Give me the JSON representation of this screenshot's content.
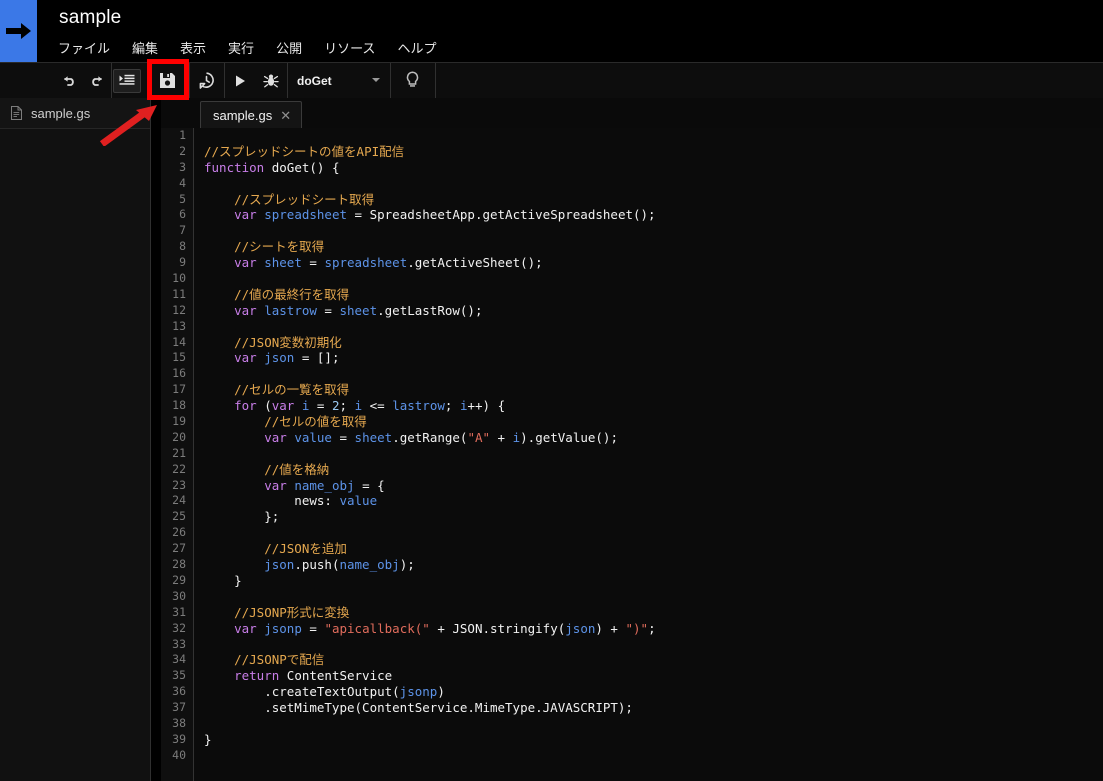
{
  "header": {
    "logo_icon": "blue-arrow-logo",
    "title": "sample",
    "menu": [
      {
        "label": "ファイル",
        "name": "menu-file"
      },
      {
        "label": "編集",
        "name": "menu-edit"
      },
      {
        "label": "表示",
        "name": "menu-view"
      },
      {
        "label": "実行",
        "name": "menu-run"
      },
      {
        "label": "公開",
        "name": "menu-publish"
      },
      {
        "label": "リソース",
        "name": "menu-resources"
      },
      {
        "label": "ヘルプ",
        "name": "menu-help"
      }
    ]
  },
  "toolbar": {
    "undo_icon": "undo-icon",
    "redo_icon": "redo-icon",
    "indent_icon": "indent-icon",
    "save_icon": "save-icon",
    "history_icon": "clock-history-icon",
    "run_icon": "run-play-icon",
    "debug_icon": "debug-bug-icon",
    "function_select": "doGet",
    "caret_icon": "chevron-down-icon",
    "hint_icon": "lightbulb-icon"
  },
  "annotation": {
    "highlight_color": "#FF0000",
    "highlight_target": "save-icon",
    "arrow_color": "#E02020"
  },
  "sidebar": {
    "files": [
      {
        "label": "sample.gs",
        "icon": "file-script-icon"
      }
    ]
  },
  "editor": {
    "tabs": [
      {
        "label": "sample.gs",
        "close_icon": "close-icon",
        "active": true
      }
    ],
    "line_count": 40,
    "lines": [
      [],
      [
        {
          "t": "//スプレッドシートの値をAPI配信",
          "c": "c-com"
        }
      ],
      [
        {
          "t": "function",
          "c": "c-kw"
        },
        {
          "t": " doGet() {",
          "c": "c-pln"
        }
      ],
      [],
      [
        {
          "t": "    //スプレッドシート取得",
          "c": "c-com"
        }
      ],
      [
        {
          "t": "    ",
          "c": "c-pln"
        },
        {
          "t": "var",
          "c": "c-kw"
        },
        {
          "t": " ",
          "c": "c-pln"
        },
        {
          "t": "spreadsheet",
          "c": "c-var"
        },
        {
          "t": " = SpreadsheetApp.getActiveSpreadsheet();",
          "c": "c-pln"
        }
      ],
      [],
      [
        {
          "t": "    //シートを取得",
          "c": "c-com"
        }
      ],
      [
        {
          "t": "    ",
          "c": "c-pln"
        },
        {
          "t": "var",
          "c": "c-kw"
        },
        {
          "t": " ",
          "c": "c-pln"
        },
        {
          "t": "sheet",
          "c": "c-var"
        },
        {
          "t": " = ",
          "c": "c-pln"
        },
        {
          "t": "spreadsheet",
          "c": "c-var"
        },
        {
          "t": ".getActiveSheet();",
          "c": "c-pln"
        }
      ],
      [],
      [
        {
          "t": "    //値の最終行を取得",
          "c": "c-com"
        }
      ],
      [
        {
          "t": "    ",
          "c": "c-pln"
        },
        {
          "t": "var",
          "c": "c-kw"
        },
        {
          "t": " ",
          "c": "c-pln"
        },
        {
          "t": "lastrow",
          "c": "c-var"
        },
        {
          "t": " = ",
          "c": "c-pln"
        },
        {
          "t": "sheet",
          "c": "c-var"
        },
        {
          "t": ".getLastRow();",
          "c": "c-pln"
        }
      ],
      [],
      [
        {
          "t": "    //JSON変数初期化",
          "c": "c-com"
        }
      ],
      [
        {
          "t": "    ",
          "c": "c-pln"
        },
        {
          "t": "var",
          "c": "c-kw"
        },
        {
          "t": " ",
          "c": "c-pln"
        },
        {
          "t": "json",
          "c": "c-var"
        },
        {
          "t": " = [];",
          "c": "c-pln"
        }
      ],
      [],
      [
        {
          "t": "    //セルの一覧を取得",
          "c": "c-com"
        }
      ],
      [
        {
          "t": "    ",
          "c": "c-pln"
        },
        {
          "t": "for",
          "c": "c-kw"
        },
        {
          "t": " (",
          "c": "c-pln"
        },
        {
          "t": "var",
          "c": "c-kw"
        },
        {
          "t": " ",
          "c": "c-pln"
        },
        {
          "t": "i",
          "c": "c-var"
        },
        {
          "t": " = ",
          "c": "c-pln"
        },
        {
          "t": "2",
          "c": "c-num"
        },
        {
          "t": "; ",
          "c": "c-pln"
        },
        {
          "t": "i",
          "c": "c-var"
        },
        {
          "t": " <= ",
          "c": "c-pln"
        },
        {
          "t": "lastrow",
          "c": "c-var"
        },
        {
          "t": "; ",
          "c": "c-pln"
        },
        {
          "t": "i",
          "c": "c-var"
        },
        {
          "t": "++) {",
          "c": "c-pln"
        }
      ],
      [
        {
          "t": "        //セルの値を取得",
          "c": "c-com"
        }
      ],
      [
        {
          "t": "        ",
          "c": "c-pln"
        },
        {
          "t": "var",
          "c": "c-kw"
        },
        {
          "t": " ",
          "c": "c-pln"
        },
        {
          "t": "value",
          "c": "c-var"
        },
        {
          "t": " = ",
          "c": "c-pln"
        },
        {
          "t": "sheet",
          "c": "c-var"
        },
        {
          "t": ".getRange(",
          "c": "c-pln"
        },
        {
          "t": "\"A\"",
          "c": "c-str"
        },
        {
          "t": " + ",
          "c": "c-pln"
        },
        {
          "t": "i",
          "c": "c-var"
        },
        {
          "t": ").getValue();",
          "c": "c-pln"
        }
      ],
      [],
      [
        {
          "t": "        //値を格納",
          "c": "c-com"
        }
      ],
      [
        {
          "t": "        ",
          "c": "c-pln"
        },
        {
          "t": "var",
          "c": "c-kw"
        },
        {
          "t": " ",
          "c": "c-pln"
        },
        {
          "t": "name_obj",
          "c": "c-var"
        },
        {
          "t": " = {",
          "c": "c-pln"
        }
      ],
      [
        {
          "t": "            news: ",
          "c": "c-pln"
        },
        {
          "t": "value",
          "c": "c-var"
        }
      ],
      [
        {
          "t": "        };",
          "c": "c-pln"
        }
      ],
      [],
      [
        {
          "t": "        //JSONを追加",
          "c": "c-com"
        }
      ],
      [
        {
          "t": "        ",
          "c": "c-pln"
        },
        {
          "t": "json",
          "c": "c-var"
        },
        {
          "t": ".push(",
          "c": "c-pln"
        },
        {
          "t": "name_obj",
          "c": "c-var"
        },
        {
          "t": ");",
          "c": "c-pln"
        }
      ],
      [
        {
          "t": "    }",
          "c": "c-pln"
        }
      ],
      [],
      [
        {
          "t": "    //JSONP形式に変換",
          "c": "c-com"
        }
      ],
      [
        {
          "t": "    ",
          "c": "c-pln"
        },
        {
          "t": "var",
          "c": "c-kw"
        },
        {
          "t": " ",
          "c": "c-pln"
        },
        {
          "t": "jsonp",
          "c": "c-var"
        },
        {
          "t": " = ",
          "c": "c-pln"
        },
        {
          "t": "\"apicallback(\"",
          "c": "c-str"
        },
        {
          "t": " + JSON.stringify(",
          "c": "c-pln"
        },
        {
          "t": "json",
          "c": "c-var"
        },
        {
          "t": ") + ",
          "c": "c-pln"
        },
        {
          "t": "\")\"",
          "c": "c-str"
        },
        {
          "t": ";",
          "c": "c-pln"
        }
      ],
      [],
      [
        {
          "t": "    //JSONPで配信",
          "c": "c-com"
        }
      ],
      [
        {
          "t": "    ",
          "c": "c-pln"
        },
        {
          "t": "return",
          "c": "c-kw"
        },
        {
          "t": " ContentService",
          "c": "c-pln"
        }
      ],
      [
        {
          "t": "        .createTextOutput(",
          "c": "c-pln"
        },
        {
          "t": "jsonp",
          "c": "c-var"
        },
        {
          "t": ")",
          "c": "c-pln"
        }
      ],
      [
        {
          "t": "        .setMimeType(ContentService.MimeType.JAVASCRIPT);",
          "c": "c-pln"
        }
      ],
      [],
      [
        {
          "t": "}",
          "c": "c-pln"
        }
      ],
      []
    ]
  },
  "colors": {
    "accent_blue": "#3B78E7",
    "comment": "#E5A84F",
    "keyword": "#C87EE8",
    "variable": "#5D93E8",
    "string": "#E06C5C",
    "plain": "#F2F2F2",
    "background": "#0B0B0B"
  }
}
